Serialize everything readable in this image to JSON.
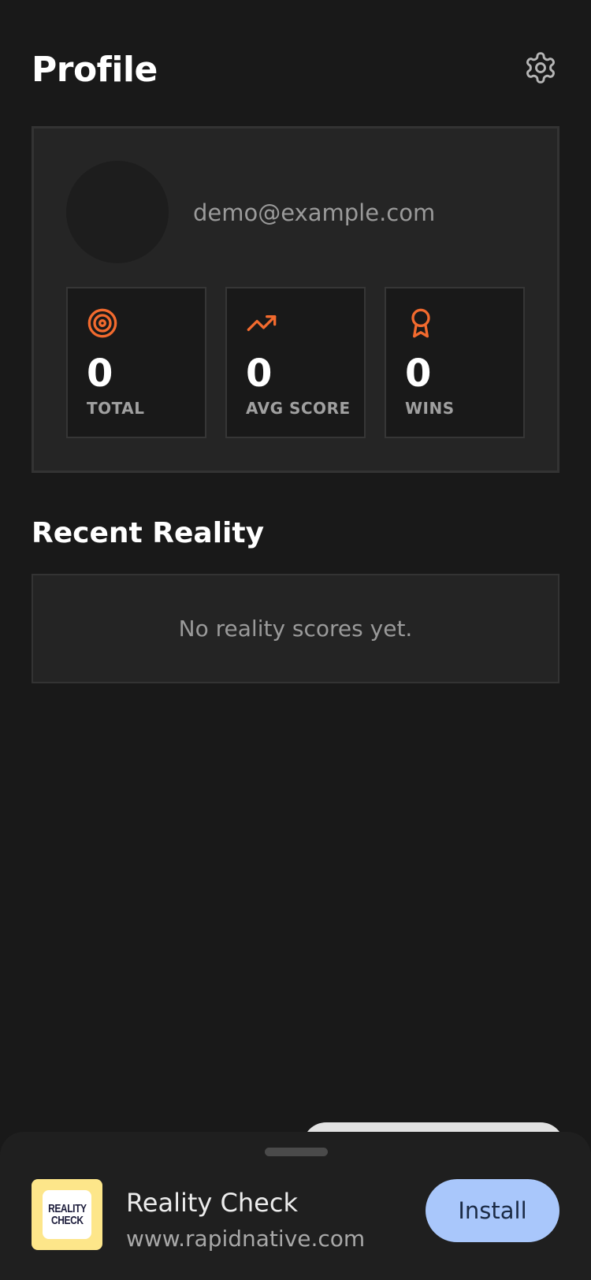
{
  "header": {
    "title": "Profile",
    "settings_icon": "gear-icon"
  },
  "profile": {
    "email": "demo@example.com",
    "stats": [
      {
        "icon": "target-icon",
        "value": "0",
        "label": "TOTAL"
      },
      {
        "icon": "trending-up-icon",
        "value": "0",
        "label": "AVG SCORE"
      },
      {
        "icon": "award-icon",
        "value": "0",
        "label": "WINS"
      }
    ]
  },
  "recent": {
    "title": "Recent Reality",
    "empty_text": "No reality scores yet."
  },
  "install_banner": {
    "app_name": "Reality Check",
    "url": "www.rapidnative.com",
    "logo_line1": "REALITY",
    "logo_line2": "CHECK",
    "button_label": "Install"
  },
  "colors": {
    "accent": "#f26a2e",
    "background": "#191919",
    "card": "#252525",
    "install_button": "#a9c7fb"
  }
}
